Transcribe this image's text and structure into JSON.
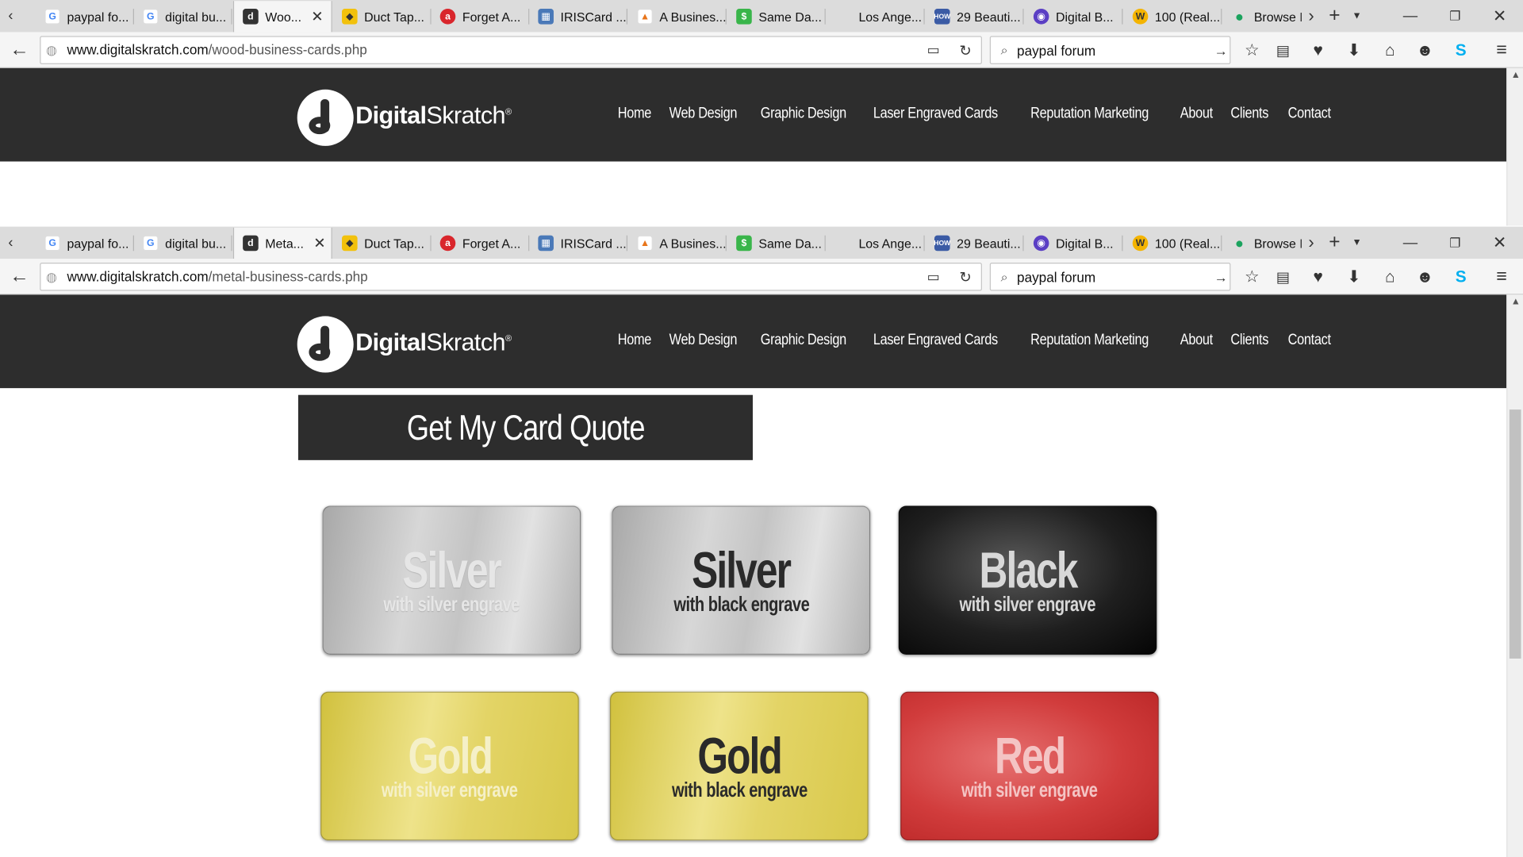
{
  "window1": {
    "tabs": [
      {
        "label": "paypal fo...",
        "icon": "google-icon"
      },
      {
        "label": "digital bu...",
        "icon": "google-icon"
      },
      {
        "label": "Woo...",
        "icon": "digital-skratch-icon",
        "active": true
      },
      {
        "label": "Duct Tap...",
        "icon": "duct-tape-icon"
      },
      {
        "label": "Forget A...",
        "icon": "red-circle-icon"
      },
      {
        "label": "IRISCard ...",
        "icon": "iriscard-icon"
      },
      {
        "label": "A Busines...",
        "icon": "business-icon"
      },
      {
        "label": "Same Da...",
        "icon": "same-day-icon"
      },
      {
        "label": "Los Ange...",
        "icon": ""
      },
      {
        "label": "29 Beauti...",
        "icon": "how-icon"
      },
      {
        "label": "Digital B...",
        "icon": "digital-b-icon"
      },
      {
        "label": "100 (Real...",
        "icon": "w-icon"
      },
      {
        "label": "Browse E",
        "icon": "drop-icon"
      }
    ],
    "url_domain": "www.digitalskratch.com",
    "url_path": "/wood-business-cards.php",
    "search": "paypal forum"
  },
  "window2": {
    "tabs": [
      {
        "label": "paypal fo...",
        "icon": "google-icon"
      },
      {
        "label": "digital bu...",
        "icon": "google-icon"
      },
      {
        "label": "Meta...",
        "icon": "digital-skratch-icon",
        "active": true
      },
      {
        "label": "Duct Tap...",
        "icon": "duct-tape-icon"
      },
      {
        "label": "Forget A...",
        "icon": "red-circle-icon"
      },
      {
        "label": "IRISCard ...",
        "icon": "iriscard-icon"
      },
      {
        "label": "A Busines...",
        "icon": "business-icon"
      },
      {
        "label": "Same Da...",
        "icon": "same-day-icon"
      },
      {
        "label": "Los Ange...",
        "icon": ""
      },
      {
        "label": "29 Beauti...",
        "icon": "how-icon"
      },
      {
        "label": "Digital B...",
        "icon": "digital-b-icon"
      },
      {
        "label": "100 (Real...",
        "icon": "w-icon"
      },
      {
        "label": "Browse E",
        "icon": "drop-icon"
      }
    ],
    "url_domain": "www.digitalskratch.com",
    "url_path": "/metal-business-cards.php",
    "search": "paypal forum"
  },
  "site": {
    "logo_word1": "Digital",
    "logo_word2": "Skratch",
    "logo_mark": "®",
    "menu": [
      "Home",
      "Web Design",
      "Graphic Design",
      "Laser Engraved Cards",
      "Reputation Marketing",
      "About",
      "Clients",
      "Contact"
    ],
    "quote_button": "Get My Card Quote",
    "cards": [
      {
        "title": "Silver",
        "subtitle": "with silver engrave"
      },
      {
        "title": "Silver",
        "subtitle": "with black engrave"
      },
      {
        "title": "Black",
        "subtitle": "with silver engrave"
      },
      {
        "title": "Gold",
        "subtitle": "with silver engrave"
      },
      {
        "title": "Gold",
        "subtitle": "with black engrave"
      },
      {
        "title": "Red",
        "subtitle": "with silver engrave"
      }
    ]
  },
  "colors": {
    "site_header": "#2d2d2d",
    "tab_bar": "#dcdcdc",
    "toolbar": "#f5f5f5",
    "skype_blue": "#00aff0"
  }
}
